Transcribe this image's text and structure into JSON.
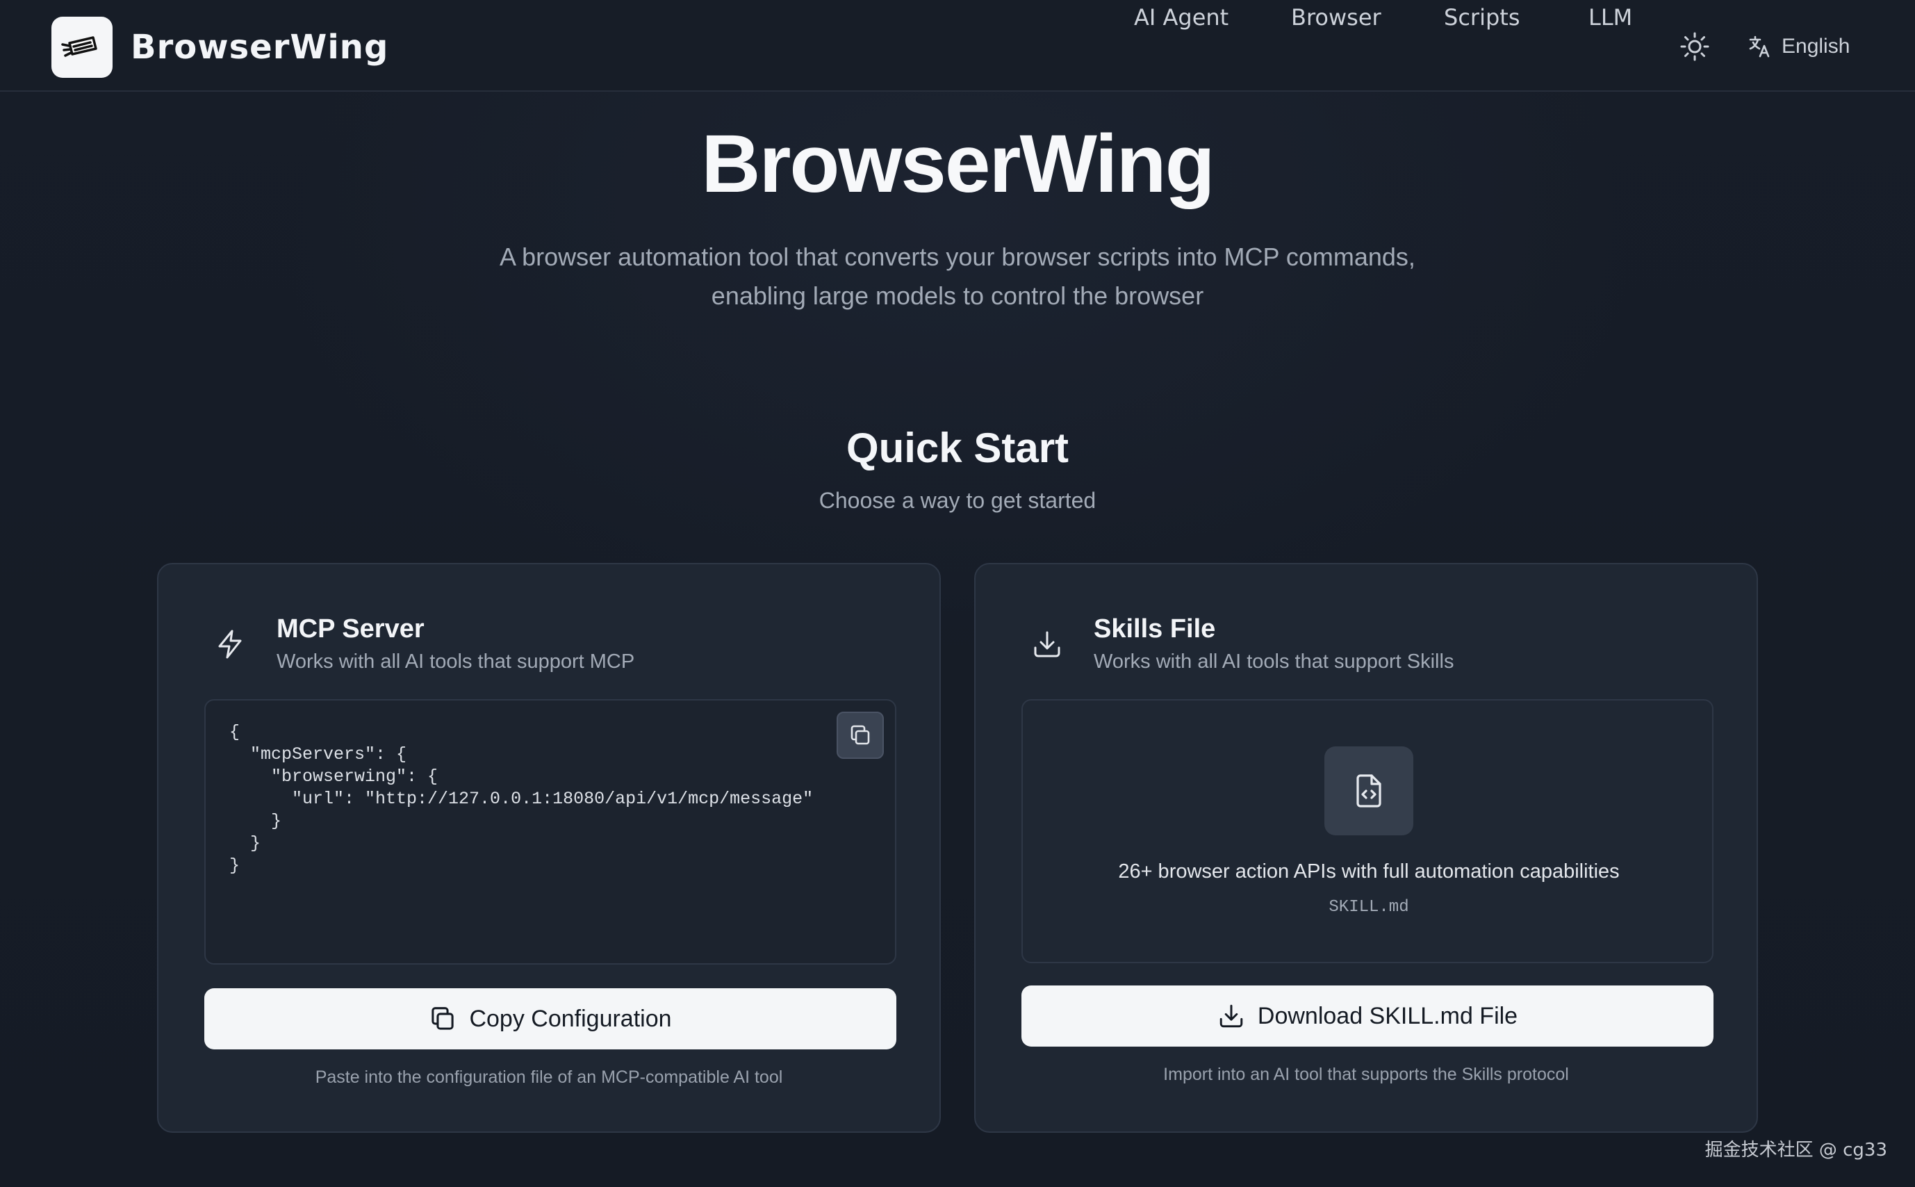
{
  "app": {
    "name": "BrowserWing",
    "logo_icon": "wing-logo-icon"
  },
  "nav": {
    "items": [
      {
        "label": "AI Agent"
      },
      {
        "label": "Browser"
      },
      {
        "label": "Scripts"
      },
      {
        "label": "LLM"
      }
    ],
    "theme_icon": "sun-icon",
    "language_icon": "translate-icon",
    "language": "English"
  },
  "hero": {
    "title": "BrowserWing",
    "subtitle_line1": "A browser automation tool that converts your browser scripts into MCP commands,",
    "subtitle_line2": "enabling large models to control the browser"
  },
  "quick_start": {
    "title": "Quick Start",
    "subtitle": "Choose a way to get started"
  },
  "mcp_card": {
    "icon": "lightning-icon",
    "title": "MCP Server",
    "subtitle": "Works with all AI tools that support MCP",
    "config_code": "{\n  \"mcpServers\": {\n    \"browserwing\": {\n      \"url\": \"http://127.0.0.1:18080/api/v1/mcp/message\"\n    }\n  }\n}",
    "copy_icon": "copy-icon",
    "button_label": "Copy Configuration",
    "hint": "Paste into the configuration file of an MCP-compatible AI tool"
  },
  "skills_card": {
    "icon": "download-icon",
    "title": "Skills File",
    "subtitle": "Works with all AI tools that support Skills",
    "file_icon": "file-code-icon",
    "description": "26+ browser action APIs with full automation capabilities",
    "filename": "SKILL.md",
    "button_label": "Download SKILL.md File",
    "hint": "Import into an AI tool that supports the Skills protocol"
  },
  "watermark": "掘金技术社区 @ cg33",
  "colors": {
    "background": "#161c26",
    "card": "#1f2733",
    "border": "#2e3746",
    "button": "#f4f6f8",
    "text_muted": "#a3abb7"
  }
}
